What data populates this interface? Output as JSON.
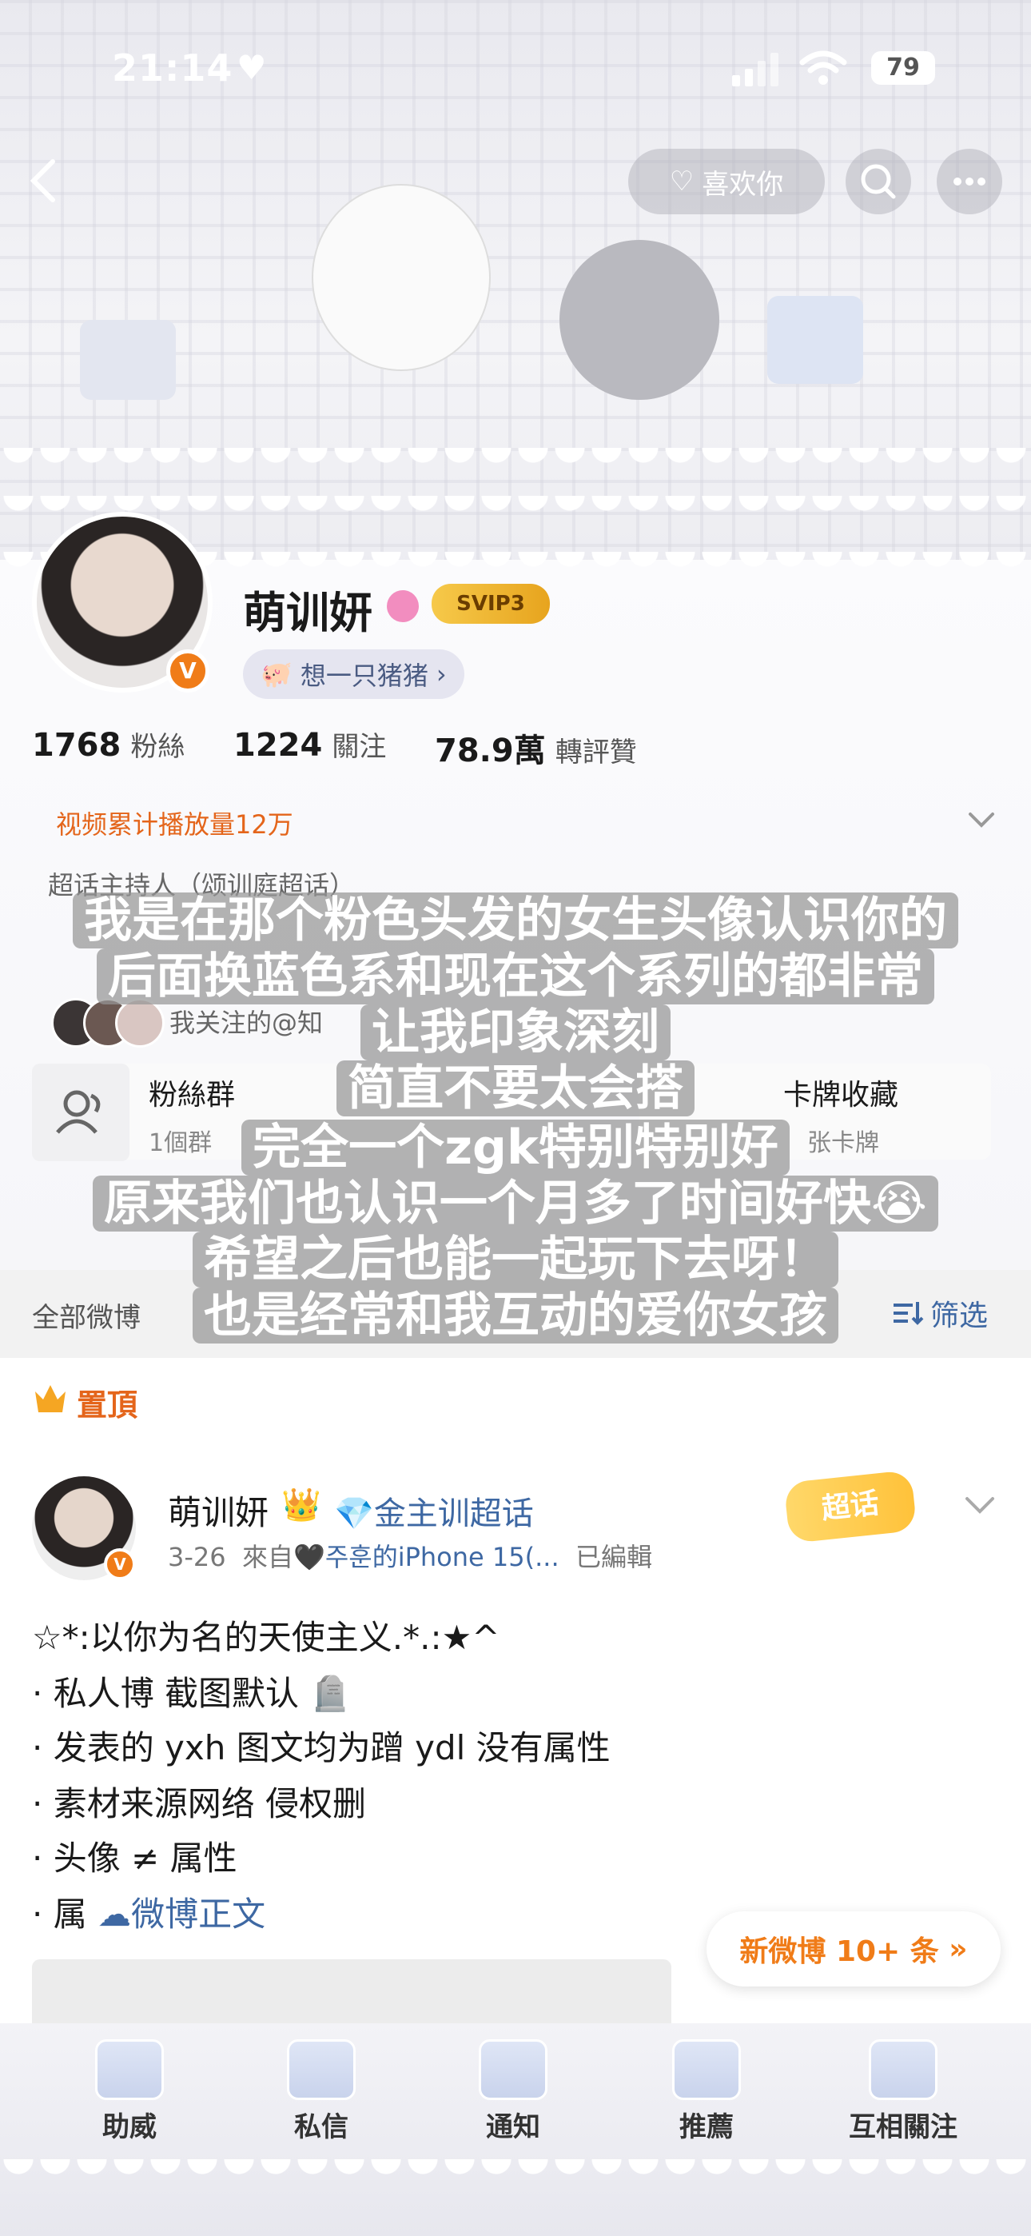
{
  "status_bar": {
    "time": "21:14",
    "battery": "79"
  },
  "nav": {
    "like_label": "喜欢你"
  },
  "profile": {
    "nickname": "萌训妍",
    "vip_badge": "SVIP3",
    "verified_mark": "V",
    "signature": "想一只猪猪",
    "stats": [
      {
        "value": "1768",
        "label": "粉絲"
      },
      {
        "value": "1224",
        "label": "關注"
      },
      {
        "value": "78.9萬",
        "label": "轉評贊"
      }
    ],
    "video_stat": "视频累计播放量12万",
    "super_topic": "超话主持人（颂训庭超话）",
    "mutual_follow": "我关注的@知",
    "cards": {
      "fan_group": {
        "title": "粉絲群",
        "sub": "1個群"
      },
      "card_collect": {
        "title": "卡牌收藏",
        "sub": "张卡牌"
      }
    }
  },
  "overlay_lines": [
    "我是在那个粉色头发的女生头像认识你的",
    "后面换蓝色系和现在这个系列的都非常",
    "让我印象深刻",
    "简直不要太会搭",
    "完全一个zgk特别特别好",
    "原来我们也认识一个月多了时间好快😭",
    "希望之后也能一起玩下去呀！",
    "也是经常和我互动的爱你女孩"
  ],
  "tabs": {
    "all": "全部微博",
    "filter": "筛选"
  },
  "pinned": {
    "label": "置頂",
    "author": "萌训妍",
    "crown": "👑",
    "topic": "金主训超话",
    "date": "3-26",
    "from": "來自",
    "device": "주훈的iPhone 15(...",
    "edited": "已編輯",
    "sticker": "超话",
    "lines": [
      "☆*:以你为名的天使主义.*.:★^",
      "· 私人博 截图默认 🪦",
      "· 发表的 yxh 图文均为蹭 ydl 没有属性",
      "· 素材来源网络 侵权删",
      "· 头像 ≠ 属性"
    ],
    "last_prefix": "· 属",
    "last_link": "微博正文"
  },
  "new_posts": "新微博 10+ 条",
  "bottom_nav": [
    {
      "label": "助威",
      "icon": "gift-icon"
    },
    {
      "label": "私信",
      "icon": "message-icon"
    },
    {
      "label": "通知",
      "icon": "bell-icon"
    },
    {
      "label": "推薦",
      "icon": "recommend-icon"
    },
    {
      "label": "互相關注",
      "icon": "follow-icon"
    }
  ],
  "colors": {
    "accent": "#e4651b",
    "link": "#3e68a3",
    "verified": "#f07c18"
  }
}
